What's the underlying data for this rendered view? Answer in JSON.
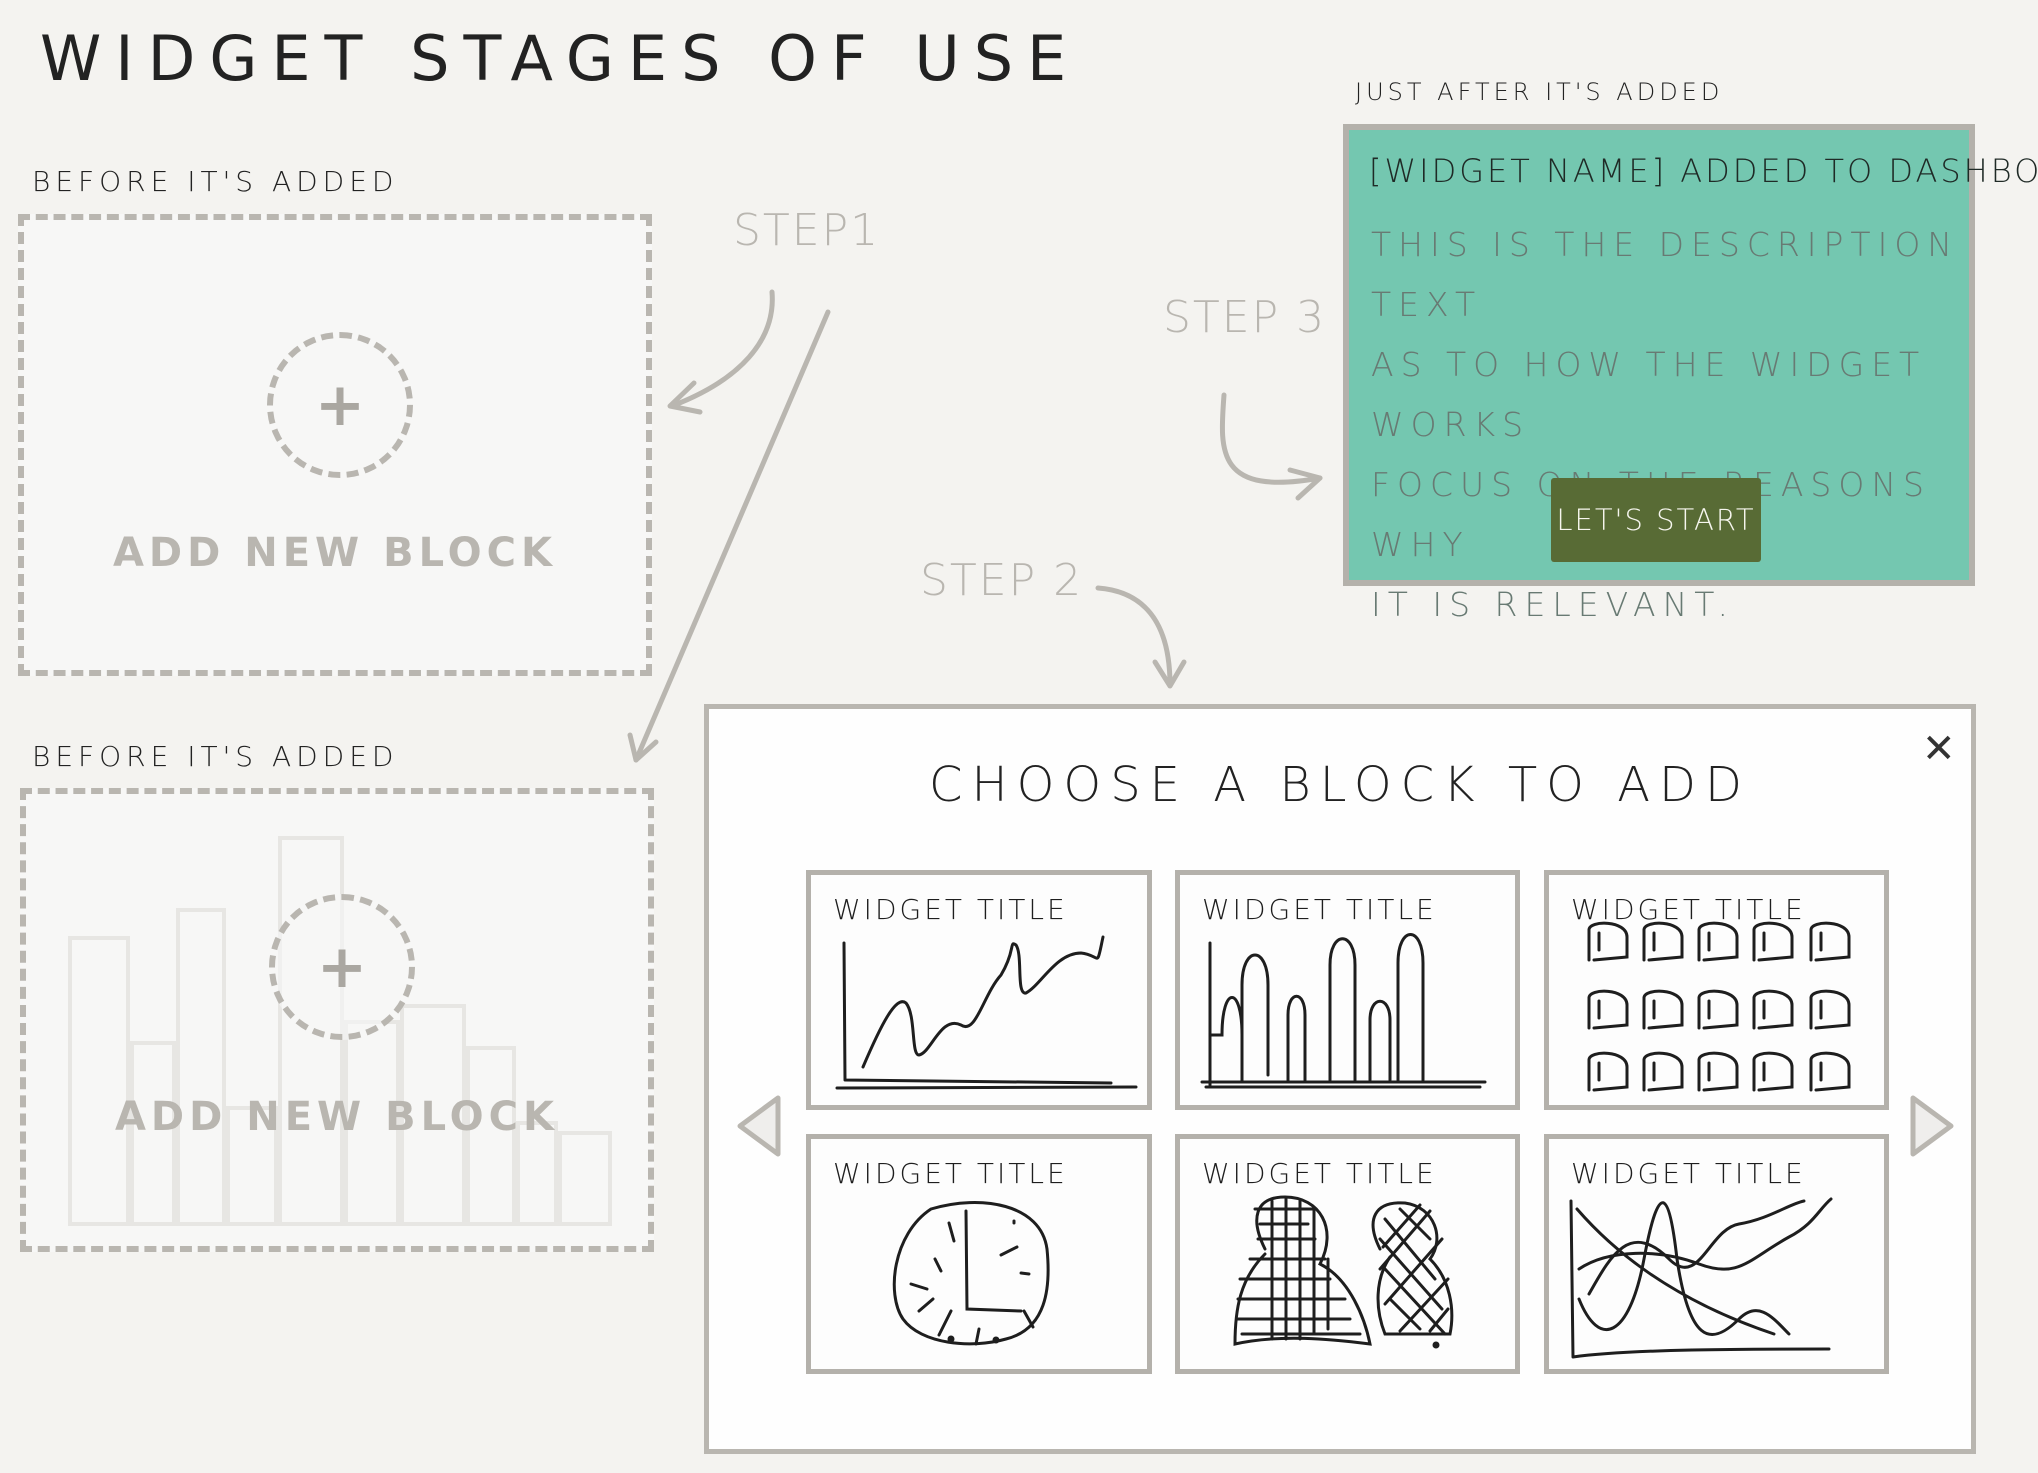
{
  "page": {
    "title": "WIDGET STAGES OF USE"
  },
  "stage_before_1": {
    "label": "BEFORE IT'S ADDED",
    "add_text": "ADD NEW BLOCK",
    "plus": "+"
  },
  "stage_before_2": {
    "label": "BEFORE IT'S ADDED",
    "add_text": "ADD NEW BLOCK",
    "plus": "+"
  },
  "steps": {
    "step1": "STEP1",
    "step2": "STEP 2",
    "step3": "STEP 3"
  },
  "stage_after": {
    "label": "JUST AFTER IT'S ADDED",
    "heading": "[WIDGET NAME] ADDED TO DASHBOARD",
    "description_lines": [
      "THIS IS THE DESCRIPTION TEXT",
      "AS TO HOW THE WIDGET WORKS",
      "FOCUS ON THE REASONS WHY",
      "IT IS RELEVANT."
    ],
    "button_label": "LET'S START"
  },
  "modal": {
    "title": "CHOOSE A BLOCK TO ADD",
    "close": "✕",
    "cards": [
      {
        "title": "WIDGET TITLE",
        "type": "line-chart"
      },
      {
        "title": "WIDGET TITLE",
        "type": "bar-chart"
      },
      {
        "title": "WIDGET TITLE",
        "type": "icon-grid"
      },
      {
        "title": "WIDGET TITLE",
        "type": "clock"
      },
      {
        "title": "WIDGET TITLE",
        "type": "people-map"
      },
      {
        "title": "WIDGET TITLE",
        "type": "multi-line-chart"
      }
    ]
  },
  "colors": {
    "background": "#f4f3f0",
    "accent_teal": "#74c7b0",
    "button_green": "#586b35",
    "stroke_grey": "#b9b6b0"
  }
}
